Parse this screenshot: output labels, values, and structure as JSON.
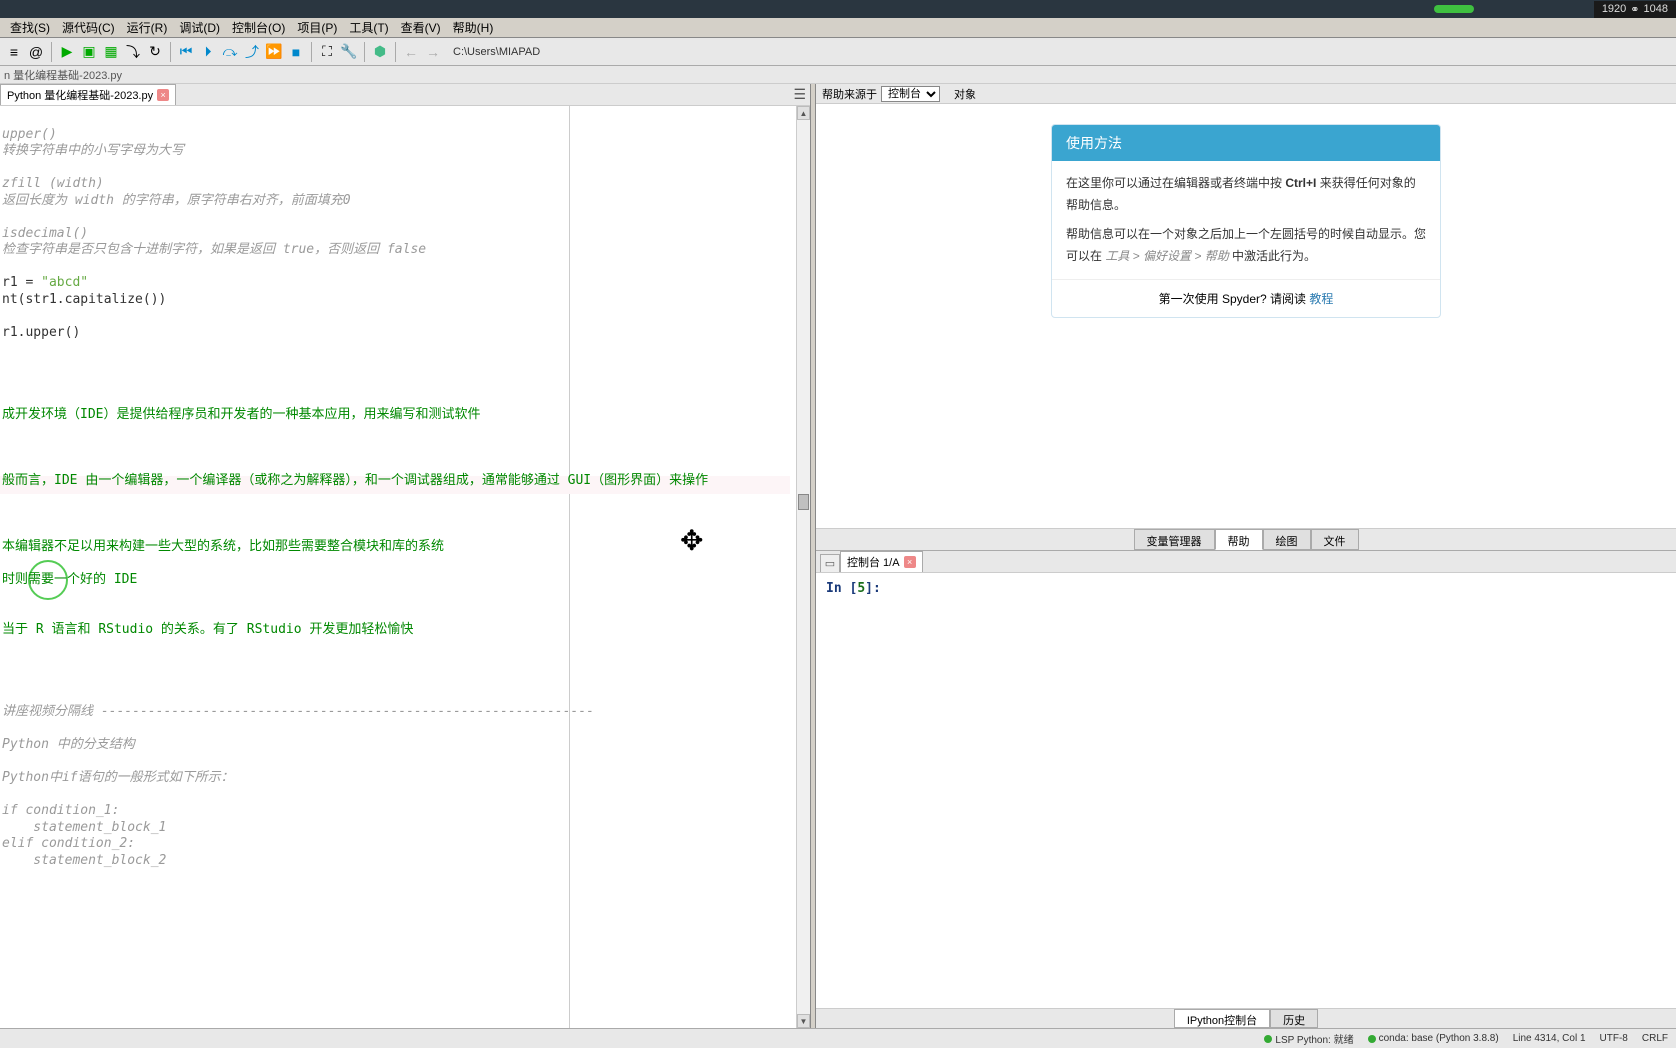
{
  "titlebar": {
    "resolution_w": "1920",
    "link_icon": "⚭",
    "resolution_h": "1048"
  },
  "menus": [
    "查找(S)",
    "源代码(C)",
    "运行(R)",
    "调试(D)",
    "控制台(O)",
    "项目(P)",
    "工具(T)",
    "查看(V)",
    "帮助(H)"
  ],
  "toolbar_path": "C:\\Users\\MIAPAD",
  "breadcrumb": "n 量化编程基础-2023.py",
  "editor_tab": "Python 量化编程基础-2023.py",
  "code": {
    "l1": "upper()",
    "l2": "转换字符串中的小写字母为大写",
    "l3": "zfill (width)",
    "l4": "返回长度为 width 的字符串，原字符串右对齐，前面填充0",
    "l5": "isdecimal()",
    "l6": "检查字符串是否只包含十进制字符，如果是返回 true，否则返回 false",
    "l7a": "r1 = ",
    "l7b": "\"abcd\"",
    "l8": "nt(str1.capitalize())",
    "l9": "r1.upper()",
    "l10a": "成开发环境（IDE）是提供给程序员和开发者的一种基本应用，用来编写和测试软件",
    "l11a": "般而言，",
    "l11b": "IDE",
    "l11c": " 由一个编辑器，一个编译器（或称之为解释器），和一个调试器组成，通常能够通过 ",
    "l11d": "GUI",
    "l11e": "（图形界面）来操作",
    "l12": "本编辑器不足以用来构建一些大型的系统，比如那些需要整合模块和库的系统",
    "l13a": "时则需要一个好的 ",
    "l13b": "IDE",
    "l14a": "当于 ",
    "l14b": "R",
    "l14c": " 语言和 ",
    "l14d": "RStudio",
    "l14e": " 的关系。有了 ",
    "l14f": "RStudio",
    "l14g": " 开发更加轻松愉快",
    "l15": "讲座视频分隔线 ---------------------------------------------------------------",
    "l16": "Python 中的分支结构",
    "l17": "Python中if语句的一般形式如下所示：",
    "l18": "if condition_1:",
    "l19": "    statement_block_1",
    "l20": "elif condition_2:",
    "l21": "    statement_block_2"
  },
  "help": {
    "header_label": "帮助来源于",
    "select_value": "控制台",
    "header_extra": "对象",
    "card_title": "使用方法",
    "p1a": "在这里你可以通过在编辑器或者终端中按 ",
    "p1b": "Ctrl+I",
    "p1c": " 来获得任何对象的帮助信息。",
    "p2a": "帮助信息可以在一个对象之后加上一个左圆括号的时候自动显示。您可以在 ",
    "p2b": "工具 > 偏好设置 > 帮助",
    "p2c": " 中激活此行为。",
    "footer_text": "第一次使用 Spyder? 请阅读 ",
    "footer_link": "教程",
    "tabs": [
      "变量管理器",
      "帮助",
      "绘图",
      "文件"
    ]
  },
  "console": {
    "tab_label": "控制台 1/A",
    "prompt_in": "In [",
    "prompt_num": "5",
    "prompt_close": "]:",
    "bottom_tabs": [
      "IPython控制台",
      "历史"
    ]
  },
  "status": {
    "lsp": "LSP Python: 就绪",
    "conda": "conda: base (Python 3.8.8)",
    "line_col": "Line 4314, Col 1",
    "encoding": "UTF-8",
    "eol": "CRLF"
  }
}
